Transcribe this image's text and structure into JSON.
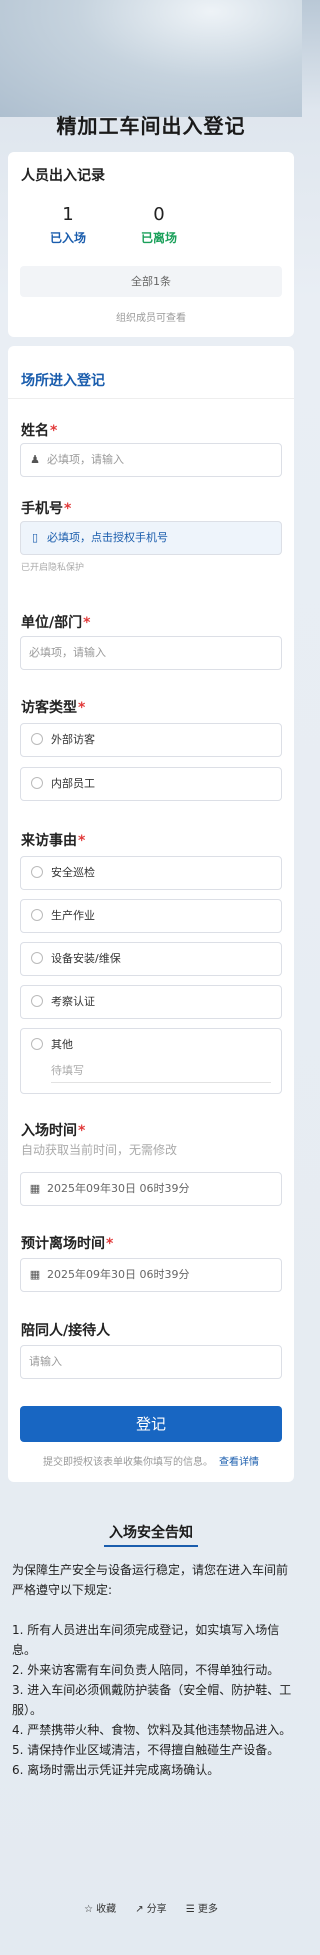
{
  "page": {
    "title": "精加工车间出入登记"
  },
  "records": {
    "title": "人员出入记录",
    "entered_count": "1",
    "entered_label": "已入场",
    "left_count": "0",
    "left_label": "已离场",
    "all_button": "全部1条",
    "visibility_note": "组织成员可查看"
  },
  "form": {
    "section_title": "场所进入登记",
    "name": {
      "label": "姓名",
      "placeholder": "必填项，请输入",
      "icon": "person-icon"
    },
    "phone": {
      "label": "手机号",
      "placeholder": "必填项，点击授权手机号",
      "icon": "phone-icon",
      "hint": "已开启隐私保护"
    },
    "dept": {
      "label": "单位/部门",
      "placeholder": "必填项，请输入"
    },
    "visitor_type": {
      "label": "访客类型",
      "options": [
        "外部访客",
        "内部员工"
      ]
    },
    "reason": {
      "label": "来访事由",
      "options": [
        "安全巡检",
        "生产作业",
        "设备安装/维保",
        "考察认证",
        "其他"
      ],
      "other_placeholder": "待填写"
    },
    "entry_time": {
      "label": "入场时间",
      "hint": "自动获取当前时间，无需修改",
      "value": "2025年09年30日 06时39分"
    },
    "exit_time": {
      "label": "预计离场时间",
      "value": "2025年09年30日 06时39分"
    },
    "companion": {
      "label": "陪同人/接待人",
      "placeholder": "请输入"
    },
    "required_mark": "*",
    "submit_label": "登记",
    "agree_text": "提交即授权该表单收集你填写的信息。",
    "agree_link": "查看详情"
  },
  "notice": {
    "title": "入场安全告知",
    "paragraphs": [
      "为保障生产安全与设备运行稳定，请您在进入车间前严格遵守以下规定:",
      "",
      "1. 所有人员进出车间须完成登记，如实填写入场信息。",
      "2. 外来访客需有车间负责人陪同，不得单独行动。",
      "3. 进入车间必须佩戴防护装备（安全帽、防护鞋、工服）。",
      "4. 严禁携带火种、食物、饮料及其他违禁物品进入。",
      "5. 请保持作业区域清洁，不得擅自触碰生产设备。",
      "6. 离场时需出示凭证并完成离场确认。"
    ]
  },
  "footer": {
    "favorite": "收藏",
    "share": "分享",
    "more": "更多"
  }
}
